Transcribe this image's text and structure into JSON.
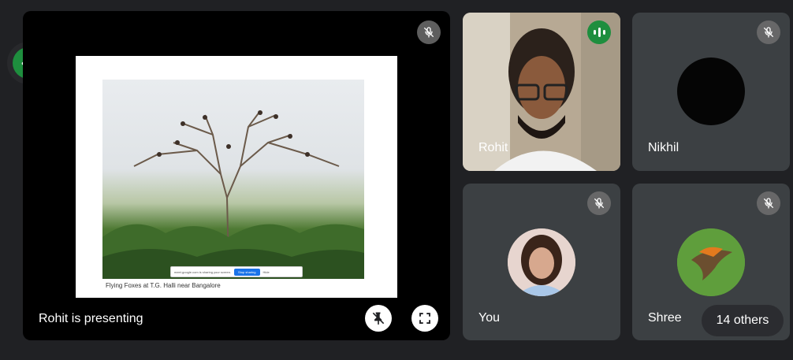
{
  "main": {
    "presenting_label": "Rohit is presenting",
    "slide": {
      "caption": "Flying Foxes at T.G. Halli near Bangalore",
      "share_text": "meet.google.com is sharing your screen.",
      "stop_label": "Stop sharing",
      "hide_label": "Hide"
    }
  },
  "participants": {
    "rohit": {
      "name": "Rohit"
    },
    "nikhil": {
      "name": "Nikhil"
    },
    "you": {
      "name": "You"
    },
    "shree": {
      "name": "Shree"
    }
  },
  "others": {
    "label": "14 others"
  },
  "colors": {
    "background": "#202124",
    "tile": "#3c4043",
    "accent": "#1e8e3e"
  },
  "icons": [
    "more-icon",
    "mic-off-icon",
    "unpin-icon",
    "fullscreen-icon",
    "speaking-indicator-icon"
  ]
}
